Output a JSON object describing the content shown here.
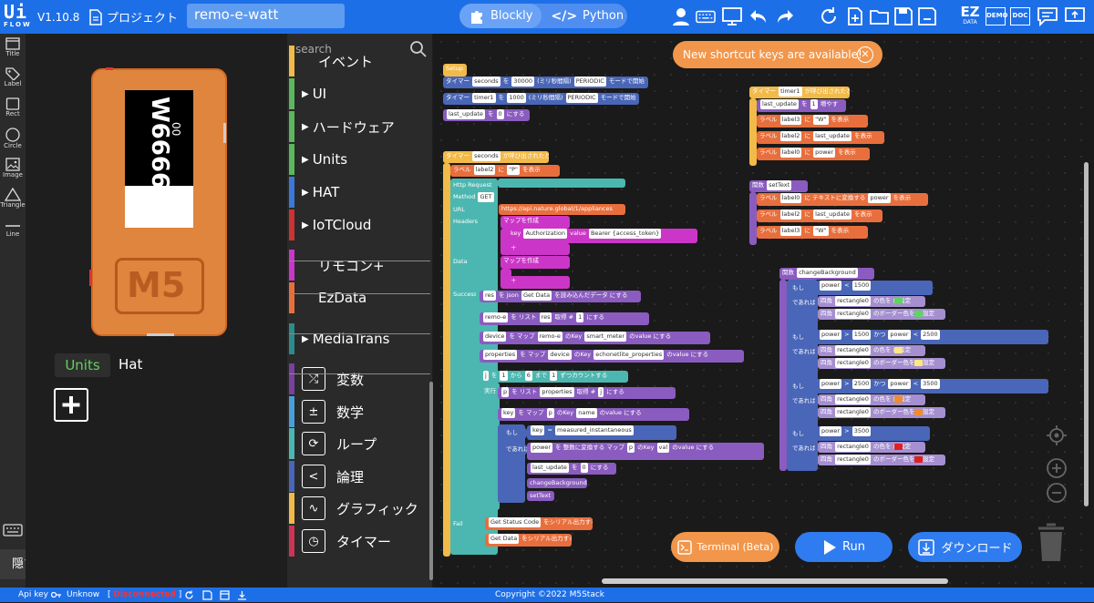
{
  "app": {
    "logo_top": "Ui",
    "logo_bottom": "FLOW",
    "version": "V1.10.8"
  },
  "header": {
    "project_label": "プロジェクト",
    "project_name": "remo-e-watt",
    "mode_blockly": "Blockly",
    "mode_python": "Python",
    "ez_top": "EZ",
    "ez_bottom": "DATA",
    "demo": "DEMO",
    "doc": "DOC"
  },
  "left_tools": [
    "Title",
    "Label",
    "Rect",
    "Circle",
    "Image",
    "Triangle",
    "Line"
  ],
  "hide_button": "隠す",
  "device": {
    "label3_text": "W6666",
    "label2_text": "00",
    "logo": "M5"
  },
  "panel_tabs": {
    "units": "Units",
    "hat": "Hat"
  },
  "toolbox": {
    "search_placeholder": "search",
    "categories": [
      {
        "label": "イベント",
        "color": "#f2ba48",
        "arrow": false
      },
      {
        "label": "UI",
        "color": "#5cb85c",
        "arrow": true
      },
      {
        "label": "ハードウェア",
        "color": "#5cb85c",
        "arrow": true
      },
      {
        "label": "Units",
        "color": "#5cb85c",
        "arrow": true
      },
      {
        "label": "HAT",
        "color": "#3c78d8",
        "arrow": true
      },
      {
        "label": "IoTCloud",
        "color": "#cc3333",
        "arrow": true
      },
      {
        "label": "リモコン+",
        "color": "#cc36c8",
        "arrow": false
      },
      {
        "label": "EzData",
        "color": "#e86f3d",
        "arrow": false
      },
      {
        "label": "MediaTrans",
        "color": "#2e8b8b",
        "arrow": true
      },
      {
        "label": "変数",
        "color": "#7b3fa0",
        "icon": "⤮"
      },
      {
        "label": "数学",
        "color": "#4a9fd8",
        "icon": "±"
      },
      {
        "label": "ループ",
        "color": "#4cb7b0",
        "icon": "⟳"
      },
      {
        "label": "論理",
        "color": "#4a66b8",
        "icon": "<"
      },
      {
        "label": "グラフィック",
        "color": "#f2ba48",
        "icon": "∿"
      },
      {
        "label": "タイマー",
        "color": "#cc3355",
        "icon": "◷"
      }
    ]
  },
  "toast": {
    "text": "New shortcut keys are available!"
  },
  "blocks": {
    "setup": {
      "title": "Setup",
      "timer_seconds": [
        "タイマー",
        "seconds",
        "を",
        "30000",
        "(ミリ秒間隔)",
        "PERIODIC",
        "モードで開始"
      ],
      "timer_timer1": [
        "タイマー",
        "timer1",
        "を",
        "1000",
        "(ミリ秒間隔)",
        "PERIODIC",
        "モードで開始"
      ],
      "last_update": [
        "last_update",
        "を",
        "0",
        "にする"
      ]
    },
    "seconds_cb": {
      "title": [
        "タイマー",
        "seconds",
        "が呼び出されたとき"
      ],
      "label2_p": [
        "ラベル",
        "label2",
        "に",
        "\"P\"",
        "を表示"
      ],
      "http_request": "Http Request",
      "method": [
        "Method",
        "GET"
      ],
      "url": [
        "URL",
        "https://api.nature.global/1/appliances"
      ],
      "headers": "Headers",
      "map_create": "マップを作成",
      "key_auth": [
        "key",
        "Authorization",
        "value",
        "Bearer {access_token}"
      ],
      "data": "Data",
      "success": "Success",
      "res_json": [
        "res",
        "を",
        "json",
        "Get Data",
        "を読み込んだデータ",
        "にする"
      ],
      "remoe": [
        "remo-e",
        "を",
        "リスト",
        "res",
        "取得",
        "#",
        "1",
        "にする"
      ],
      "device": [
        "device",
        "を",
        "マップ",
        "remo-e",
        "のKey",
        "smart_meter",
        "のvalue",
        "にする"
      ],
      "properties": [
        "properties",
        "を",
        "マップ",
        "device",
        "のKey",
        "echonetlite_properties",
        "のvalue",
        "にする"
      ],
      "loop": [
        "j",
        "を",
        "1",
        "から",
        "6",
        "まで",
        "1",
        "ずつカウントする"
      ],
      "do": "実行",
      "p_list": [
        "p",
        "を",
        "リスト",
        "properties",
        "取得",
        "#",
        "j",
        "にする"
      ],
      "key_map": [
        "key",
        "を",
        "マップ",
        "p",
        "のKey",
        "name",
        "のvalue",
        "にする"
      ],
      "if": "もし",
      "cond": [
        "key",
        "=",
        "measured_instantaneous"
      ],
      "then": "であれば",
      "power": [
        "power",
        "を",
        "整数に変換する",
        "マップ",
        "p",
        "のKey",
        "val",
        "のvalue",
        "にする"
      ],
      "last_update_zero": [
        "last_update",
        "を",
        "0",
        "にする"
      ],
      "change_bg": "changeBackground",
      "set_text": "setText",
      "fail": "Fail",
      "status_code": [
        "Get Status Code",
        "をシリアル出力する"
      ],
      "get_data": [
        "Get Data",
        "をシリアル出力する"
      ]
    },
    "timer1_cb": {
      "title": [
        "タイマー",
        "timer1",
        "が呼び出されたとき"
      ],
      "inc": [
        "last_update",
        "を",
        "1",
        "増やす"
      ],
      "l3": [
        "ラベル",
        "label3",
        "に",
        "\"W\"",
        "を表示"
      ],
      "l2": [
        "ラベル",
        "label2",
        "に",
        "last_update",
        "を表示"
      ],
      "l0": [
        "ラベル",
        "label0",
        "に",
        "power",
        "を表示"
      ]
    },
    "settext_fn": {
      "title": [
        "関数",
        "setText"
      ],
      "l0": [
        "ラベル",
        "label0",
        "に",
        "テキストに変換する",
        "power",
        "を表示"
      ],
      "l2": [
        "ラベル",
        "label2",
        "に",
        "last_update",
        "を表示"
      ],
      "l3": [
        "ラベル",
        "label3",
        "に",
        "\"W\"",
        "を表示"
      ]
    },
    "changebg_fn": {
      "title": [
        "関数",
        "changeBackground"
      ],
      "if": "もし",
      "then": "であれば",
      "c1": [
        "power",
        "<",
        "1500"
      ],
      "c2": [
        "power",
        ">",
        "1500",
        "かつ",
        "power",
        "<",
        "2500"
      ],
      "c3": [
        "power",
        ">",
        "2500",
        "かつ",
        "power",
        "<",
        "3500"
      ],
      "c4": [
        "power",
        ">",
        "3500"
      ],
      "rect_color": [
        "四角",
        "rectangle0",
        "の色を",
        "に設定"
      ],
      "rect_border": [
        "四角",
        "rectangle0",
        "のボーダー色を",
        "に設定"
      ],
      "colors": [
        "#5cd65c",
        "#ffe680",
        "#f28c28",
        "#e02020"
      ]
    }
  },
  "buttons": {
    "terminal": "Terminal (Beta)",
    "run": "Run",
    "download": "ダウンロード"
  },
  "statusbar": {
    "api_key": "Api key :",
    "unknow": "Unknow",
    "disconnected": "Disconnected",
    "copyright": "Copyright ©2022 M5Stack"
  },
  "colors": {
    "brand": "#1d6fe8",
    "device": "#e0853e"
  }
}
